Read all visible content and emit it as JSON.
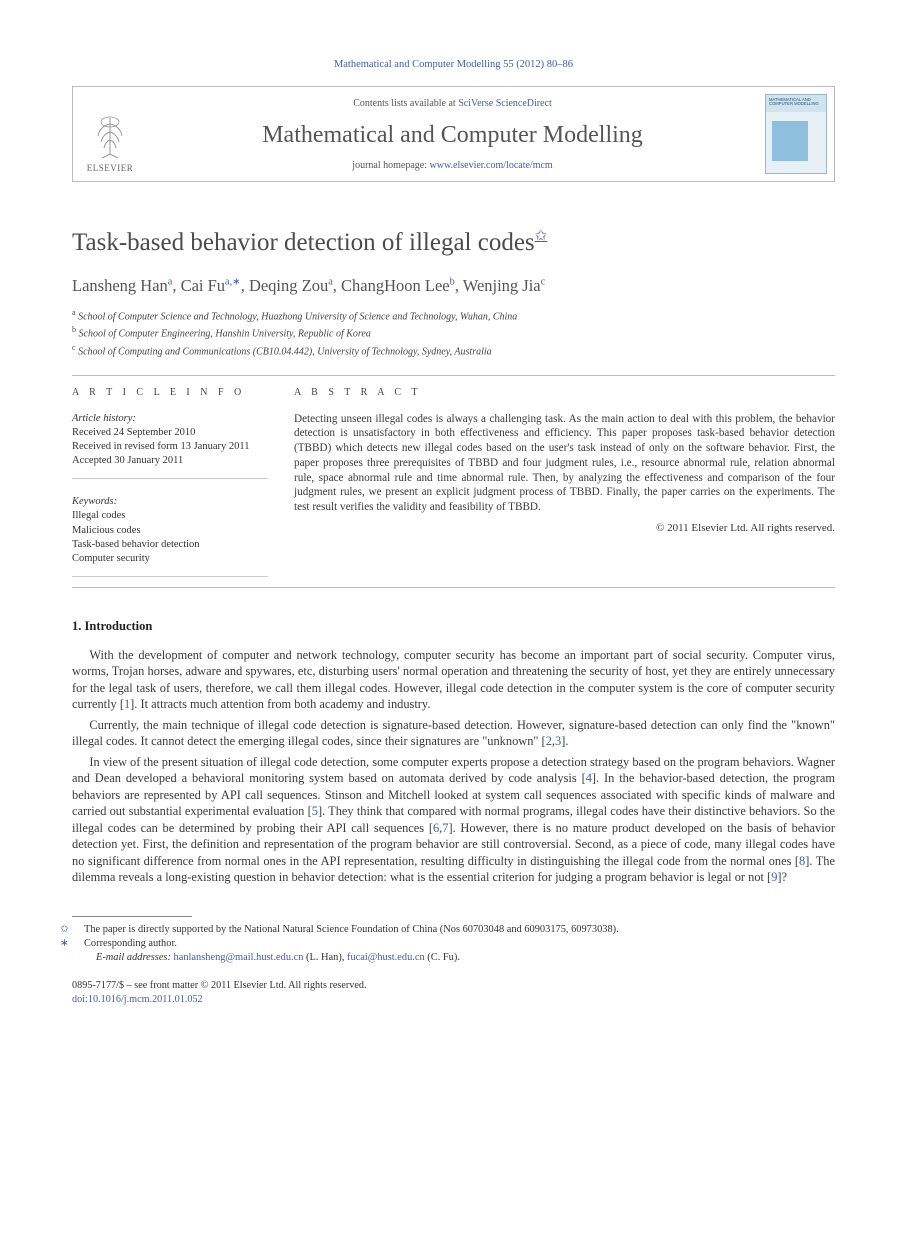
{
  "citation": "Mathematical and Computer Modelling 55 (2012) 80–86",
  "header": {
    "contents_prefix": "Contents lists available at ",
    "contents_link": "SciVerse ScienceDirect",
    "journal": "Mathematical and Computer Modelling",
    "homepage_prefix": "journal homepage: ",
    "homepage_link": "www.elsevier.com/locate/mcm",
    "publisher": "ELSEVIER",
    "cover_title": "MATHEMATICAL AND COMPUTER MODELLING"
  },
  "title": "Task-based behavior detection of illegal codes",
  "title_footnote_mark": "✩",
  "authors_line": {
    "a1": "Lansheng Han",
    "a1sup": "a",
    "a2": "Cai Fu",
    "a2sup": "a,∗",
    "a3": "Deqing Zou",
    "a3sup": "a",
    "a4": "ChangHoon Lee",
    "a4sup": "b",
    "a5": "Wenjing Jia",
    "a5sup": "c"
  },
  "affiliations": [
    {
      "sup": "a",
      "text": "School of Computer Science and Technology, Huazhong University of Science and Technology, Wuhan, China"
    },
    {
      "sup": "b",
      "text": "School of Computer Engineering, Hanshin University, Republic of Korea"
    },
    {
      "sup": "c",
      "text": "School of Computing and Communications (CB10.04.442), University of Technology, Sydney, Australia"
    }
  ],
  "info_labels": {
    "article_info": "A R T I C L E   I N F O",
    "abstract": "A B S T R A C T"
  },
  "history": {
    "label": "Article history:",
    "received": "Received 24 September 2010",
    "revised": "Received in revised form 13 January 2011",
    "accepted": "Accepted 30 January 2011"
  },
  "keywords": {
    "label": "Keywords:",
    "items": [
      "Illegal codes",
      "Malicious codes",
      "Task-based behavior detection",
      "Computer security"
    ]
  },
  "abstract": "Detecting unseen illegal codes is always a challenging task. As the main action to deal with this problem, the behavior detection is unsatisfactory in both effectiveness and efficiency. This paper proposes task-based behavior detection (TBBD) which detects new illegal codes based on the user's task instead of only on the software behavior. First, the paper proposes three prerequisites of TBBD and four judgment rules, i.e., resource abnormal rule, relation abnormal rule, space abnormal rule and time abnormal rule. Then, by analyzing the effectiveness and comparison of the four judgment rules, we present an explicit judgment process of TBBD. Finally, the paper carries on the experiments. The test result verifies the validity and feasibility of TBBD.",
  "copyright": "© 2011 Elsevier Ltd. All rights reserved.",
  "section1": {
    "heading": "1. Introduction",
    "p1_a": "With the development of computer and network technology, computer security has become an important part of social security. Computer virus, worms, Trojan horses, adware and spywares, etc, disturbing users' normal operation and threatening the security of host, yet they are entirely unnecessary for the legal task of users, therefore, we call them illegal codes. However, illegal code detection in the computer system is the core of computer security currently [",
    "p1_ref1": "1",
    "p1_b": "]. It attracts much attention from both academy and industry.",
    "p2_a": "Currently, the main technique of illegal code detection is signature-based detection. However, signature-based detection can only find the \"known\" illegal codes. It cannot detect the emerging illegal codes, since their signatures are \"unknown\" [",
    "p2_ref1": "2",
    "p2_ref2": "3",
    "p2_b": "].",
    "p3_a": "In view of the present situation of illegal code detection, some computer experts propose a detection strategy based on the program behaviors. Wagner and Dean developed a behavioral monitoring system based on automata derived by code analysis [",
    "p3_ref1": "4",
    "p3_b": "]. In the behavior-based detection, the program behaviors are represented by API call sequences. Stinson and Mitchell looked at system call sequences associated with specific kinds of malware and carried out substantial experimental evaluation [",
    "p3_ref2": "5",
    "p3_c": "]. They think that compared with normal programs, illegal codes have their distinctive behaviors. So the illegal codes can be determined by probing their API call sequences [",
    "p3_ref3": "6",
    "p3_ref4": "7",
    "p3_d": "]. However, there is no mature product developed on the basis of behavior detection yet. First, the definition and representation of the program behavior are still controversial. Second, as a piece of code, many illegal codes have no significant difference from normal ones in the API representation, resulting difficulty in distinguishing the illegal code from the normal ones [",
    "p3_ref5": "8",
    "p3_e": "]. The dilemma reveals a long-existing question in behavior detection: what is the essential criterion for judging a program behavior is legal or not [",
    "p3_ref6": "9",
    "p3_f": "]?"
  },
  "footnotes": {
    "fn_star": "The paper is directly supported by the National Natural Science Foundation of China (Nos 60703048 and 60903175, 60973038).",
    "fn_corr": "Corresponding author.",
    "email_label": "E-mail addresses:",
    "email1": "hanlansheng@mail.hust.edu.cn",
    "email1_who": " (L. Han), ",
    "email2": "fucai@hust.edu.cn",
    "email2_who": " (C. Fu)."
  },
  "bottom": {
    "line1": "0895-7177/$ – see front matter © 2011 Elsevier Ltd. All rights reserved.",
    "doi_label": "doi:",
    "doi": "10.1016/j.mcm.2011.01.052"
  }
}
